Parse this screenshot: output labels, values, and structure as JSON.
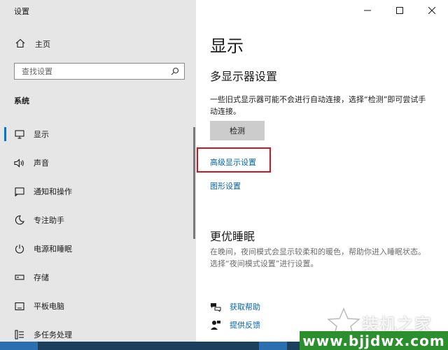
{
  "app_title": "设置",
  "sidebar": {
    "home": {
      "label": "主页",
      "icon": "home-icon"
    },
    "search": {
      "placeholder": "查找设置",
      "icon": "search-icon"
    },
    "section_label": "系统",
    "items": [
      {
        "label": "显示",
        "icon": "monitor-icon",
        "active": true
      },
      {
        "label": "声音",
        "icon": "speaker-icon"
      },
      {
        "label": "通知和操作",
        "icon": "notification-icon"
      },
      {
        "label": "专注助手",
        "icon": "moon-icon"
      },
      {
        "label": "电源和睡眠",
        "icon": "power-icon"
      },
      {
        "label": "存储",
        "icon": "storage-icon"
      },
      {
        "label": "平板电脑",
        "icon": "tablet-icon"
      },
      {
        "label": "多任务处理",
        "icon": "multitask-icon"
      }
    ]
  },
  "window_controls": {
    "minimize": "—",
    "maximize": "☐",
    "close": "✕"
  },
  "main": {
    "title": "显示",
    "multi_display": {
      "heading": "多显示器设置",
      "description": "一些旧式显示器可能不会进行自动连接，选择“检测”即可尝试手动连接。",
      "detect_button": "检测"
    },
    "links": {
      "advanced": "高级显示设置",
      "graphics": "图形设置"
    },
    "sleep": {
      "heading": "更优睡眠",
      "description": "在晚间，夜间模式会显示较柔和的暖色，帮助你进入睡眠状态。选择“夜间模式设置”进行设置。"
    },
    "help": {
      "get_help": "获取帮助",
      "feedback": "提供反馈"
    }
  },
  "watermark": {
    "brand": "装机之家",
    "url": "www.bjjdwx.com"
  },
  "colors": {
    "sidebar_bg": "#e6e6e6",
    "accent": "#0078d7",
    "link": "#0066b4",
    "highlight": "#e0101a",
    "banner": "#2b8f2e"
  }
}
